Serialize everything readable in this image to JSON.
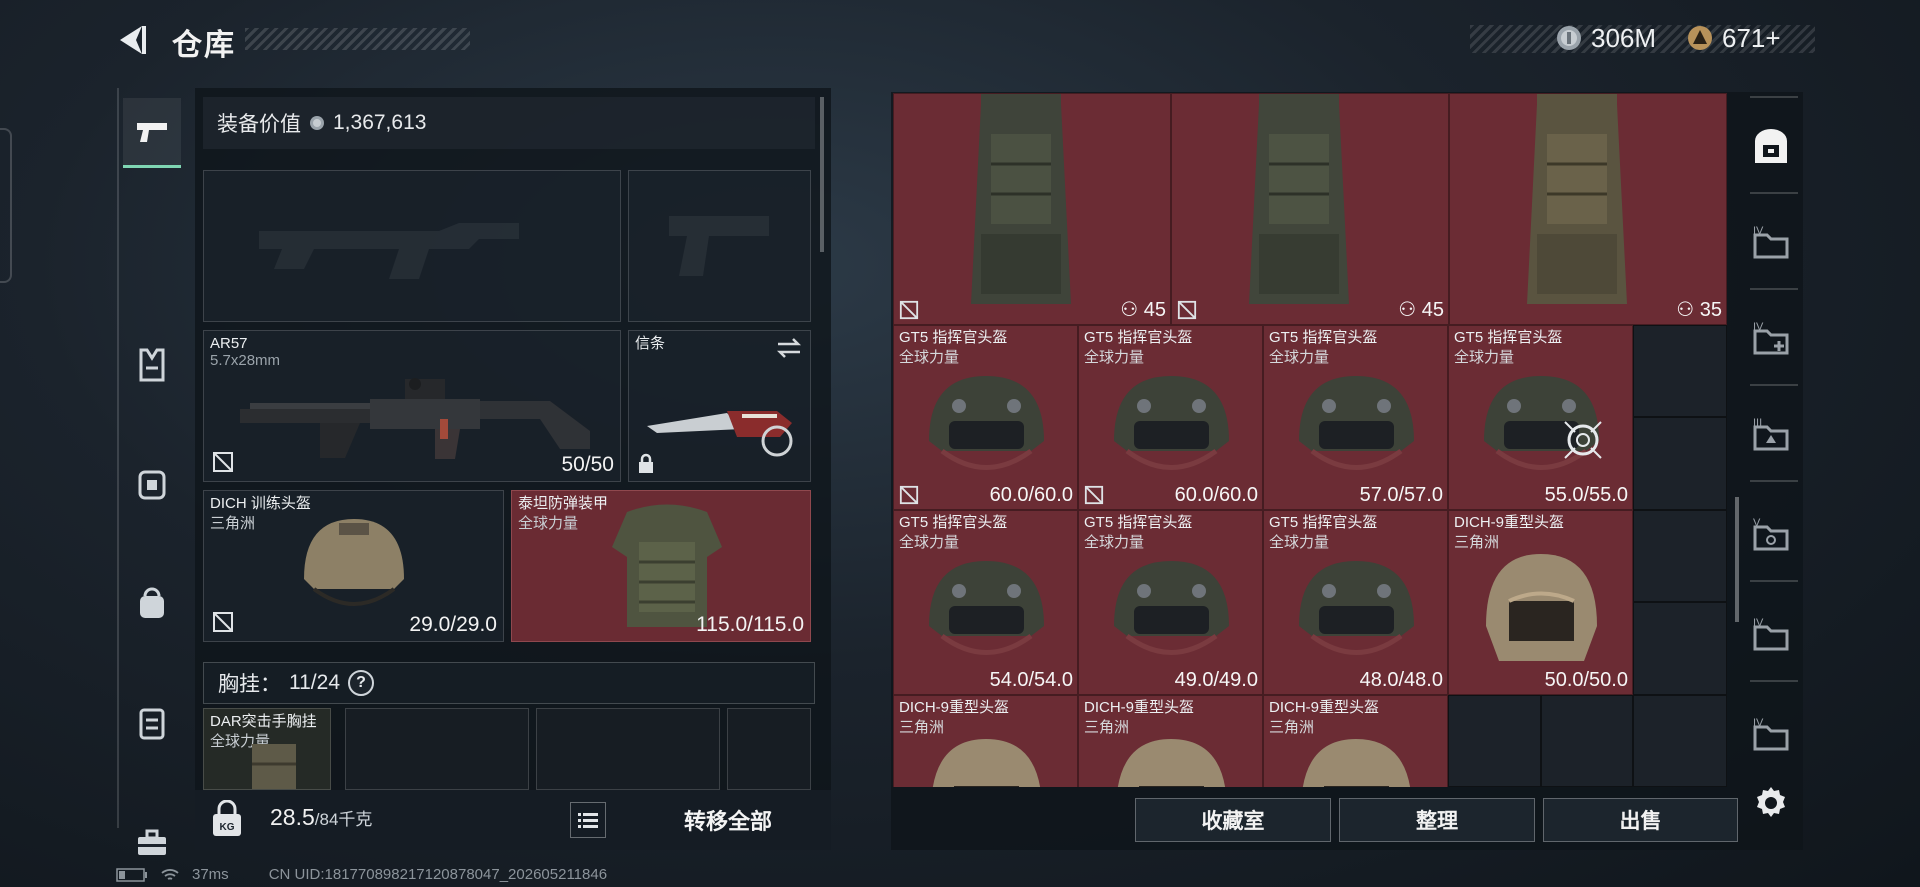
{
  "header": {
    "title": "仓库"
  },
  "currency": {
    "silver": "306M",
    "gold": "671+"
  },
  "equipment": {
    "label": "装备价值",
    "value": "1,367,613",
    "primary": {
      "name": "AR57",
      "ammo": "5.7x28mm",
      "durability": "50/50"
    },
    "secondary": {
      "name": "信条"
    },
    "helmet": {
      "name": "DICH 训练头盔",
      "sub": "三角洲",
      "durability": "29.0/29.0"
    },
    "armor": {
      "name": "泰坦防弹装甲",
      "sub": "全球力量",
      "durability": "115.0/115.0"
    },
    "chest_rig": {
      "label": "胸挂：",
      "count": "11/24",
      "help": "?",
      "item_name": "DAR突击手胸挂",
      "item_sub": "全球力量"
    }
  },
  "bottom_bar": {
    "weight": "28.5",
    "capacity": "/84千克",
    "transfer": "转移全部"
  },
  "storage": {
    "top_items": [
      {
        "count": "45"
      },
      {
        "count": "45"
      },
      {
        "count": "35"
      }
    ],
    "row1": [
      {
        "name": "GT5 指挥官头盔",
        "sub": "全球力量",
        "value": "60.0/60.0"
      },
      {
        "name": "GT5 指挥官头盔",
        "sub": "全球力量",
        "value": "60.0/60.0"
      },
      {
        "name": "GT5 指挥官头盔",
        "sub": "全球力量",
        "value": "57.0/57.0"
      },
      {
        "name": "GT5 指挥官头盔",
        "sub": "全球力量",
        "value": "55.0/55.0"
      }
    ],
    "row2": [
      {
        "name": "GT5 指挥官头盔",
        "sub": "全球力量",
        "value": "54.0/54.0"
      },
      {
        "name": "GT5 指挥官头盔",
        "sub": "全球力量",
        "value": "49.0/49.0"
      },
      {
        "name": "GT5 指挥官头盔",
        "sub": "全球力量",
        "value": "48.0/48.0"
      },
      {
        "name": "DICH-9重型头盔",
        "sub": "三角洲",
        "value": "50.0/50.0"
      }
    ],
    "row3": [
      {
        "name": "DICH-9重型头盔",
        "sub": "三角洲"
      },
      {
        "name": "DICH-9重型头盔",
        "sub": "三角洲"
      },
      {
        "name": "DICH-9重型头盔",
        "sub": "三角洲"
      }
    ]
  },
  "actions": {
    "collection": "收藏室",
    "organize": "整理",
    "sell": "出售"
  },
  "side_tabs": [
    "safe-icon",
    "container-IV",
    "container-IV-add",
    "container-III",
    "container-V",
    "container-IV-b",
    "container-IV-c",
    "settings-icon"
  ],
  "status_bar": {
    "ping": "37ms",
    "uid": "CN UID:181770898217120878047_202605211846"
  },
  "colors": {
    "accent": "#7fd6b3",
    "item_red": "#6b2c34",
    "panel": "#0e141a"
  }
}
